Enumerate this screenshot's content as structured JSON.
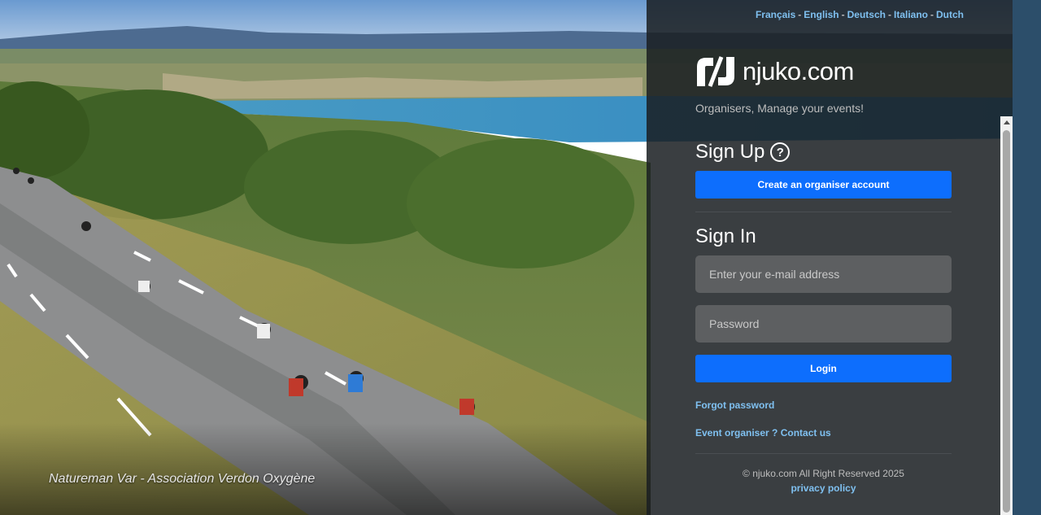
{
  "background": {
    "caption": "Natureman Var - Association Verdon Oxygène"
  },
  "languages": [
    {
      "label": "Français"
    },
    {
      "label": "English"
    },
    {
      "label": "Deutsch"
    },
    {
      "label": "Italiano"
    },
    {
      "label": "Dutch"
    }
  ],
  "brand": {
    "name": "njuko.com",
    "tagline": "Organisers, Manage your events!",
    "icon": "njuko-logo-icon"
  },
  "signup": {
    "title": "Sign Up",
    "help_icon": "question-circle-icon",
    "create_button": "Create an organiser account"
  },
  "signin": {
    "title": "Sign In",
    "email_placeholder": "Enter your e-mail address",
    "password_placeholder": "Password",
    "login_button": "Login",
    "forgot_link": "Forgot password",
    "contact_link": "Event organiser ? Contact us"
  },
  "footer": {
    "copyright": "© njuko.com All Right Reserved 2025",
    "privacy": "privacy policy"
  },
  "colors": {
    "primary": "#0d6efd",
    "link": "#7fc0f0",
    "panel": "#1a1e22"
  }
}
